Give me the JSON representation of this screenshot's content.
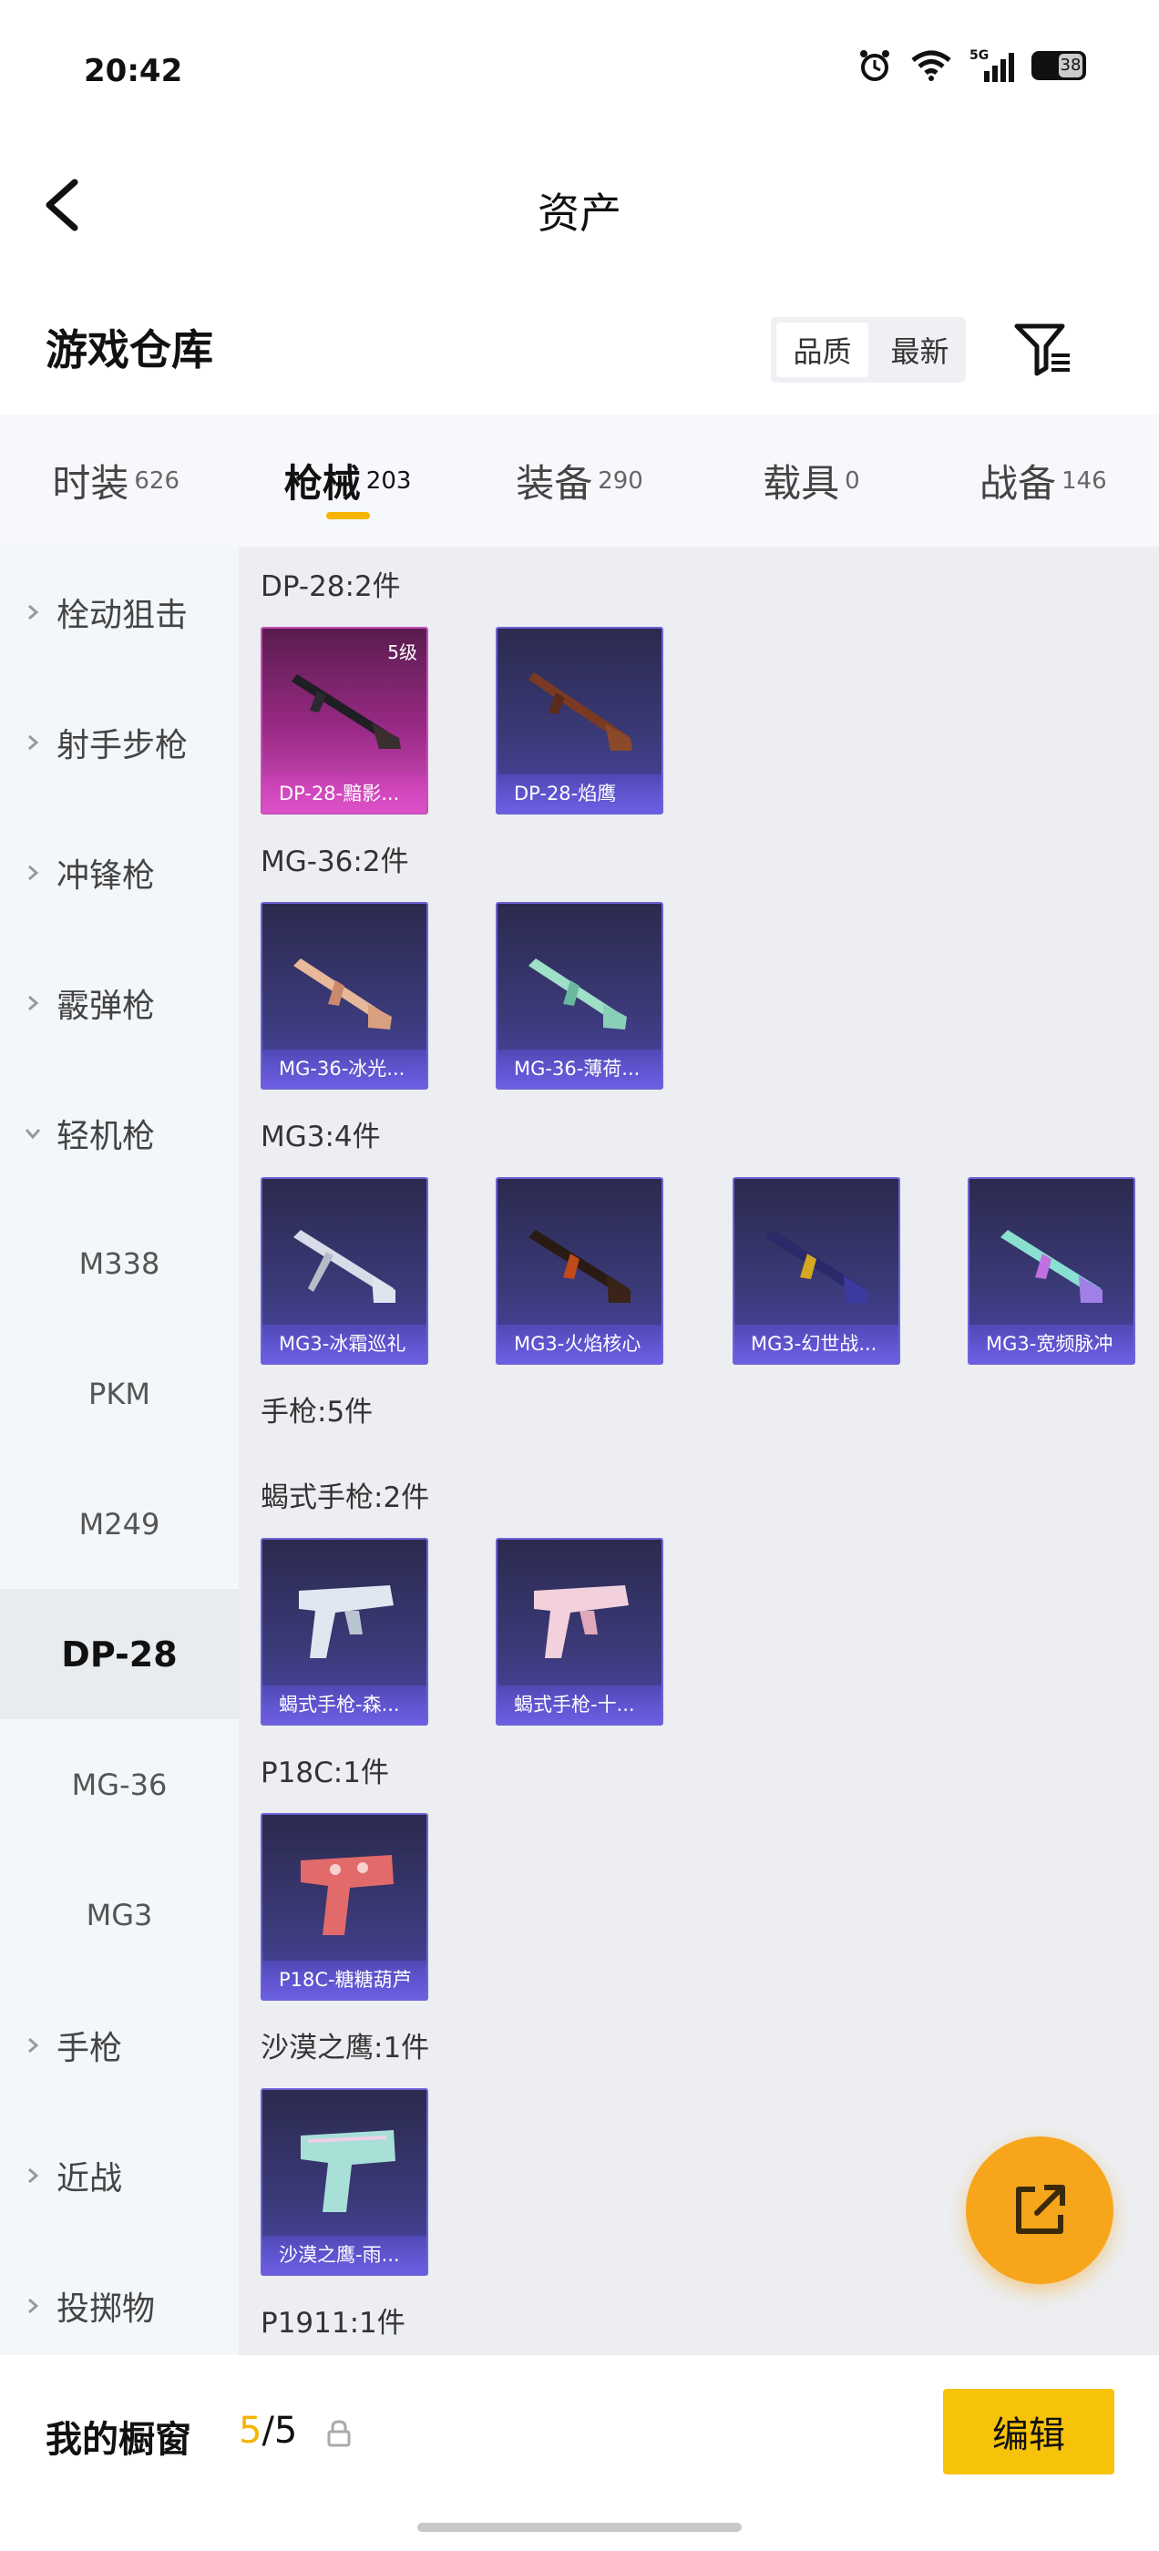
{
  "status_bar": {
    "time": "20:42",
    "battery": "38"
  },
  "header": {
    "title": "资产"
  },
  "warehouse": {
    "title": "游戏仓库",
    "sort_options": [
      "品质",
      "最新"
    ]
  },
  "tabs": [
    {
      "label": "时装",
      "count": "626"
    },
    {
      "label": "枪械",
      "count": "203"
    },
    {
      "label": "装备",
      "count": "290"
    },
    {
      "label": "载具",
      "count": "0"
    },
    {
      "label": "战备",
      "count": "146"
    }
  ],
  "sidebar": [
    {
      "label": "栓动狙击"
    },
    {
      "label": "射手步枪"
    },
    {
      "label": "冲锋枪"
    },
    {
      "label": "霰弹枪"
    },
    {
      "label": "轻机枪"
    },
    {
      "label": "M338"
    },
    {
      "label": "PKM"
    },
    {
      "label": "M249"
    },
    {
      "label": "DP-28"
    },
    {
      "label": "MG-36"
    },
    {
      "label": "MG3"
    },
    {
      "label": "手枪"
    },
    {
      "label": "近战"
    },
    {
      "label": "投掷物"
    }
  ],
  "groups": [
    {
      "title": "DP-28:2件",
      "items": [
        {
          "name": "DP-28-黯影...",
          "badge": "5级",
          "color": "pink"
        },
        {
          "name": "DP-28-焰鹰",
          "color": "purple"
        }
      ]
    },
    {
      "title": "MG-36:2件",
      "items": [
        {
          "name": "MG-36-冰光...",
          "color": "purple"
        },
        {
          "name": "MG-36-薄荷...",
          "color": "purple"
        }
      ]
    },
    {
      "title": "MG3:4件",
      "items": [
        {
          "name": "MG3-冰霜巡礼",
          "color": "purple"
        },
        {
          "name": "MG3-火焰核心",
          "color": "purple"
        },
        {
          "name": "MG3-幻世战...",
          "color": "purple"
        },
        {
          "name": "MG3-宽频脉冲",
          "color": "purple"
        }
      ]
    },
    {
      "title": "手枪:5件",
      "items": []
    },
    {
      "title": "蝎式手枪:2件",
      "items": [
        {
          "name": "蝎式手枪-森...",
          "color": "purple"
        },
        {
          "name": "蝎式手枪-十...",
          "color": "purple"
        }
      ]
    },
    {
      "title": "P18C:1件",
      "items": [
        {
          "name": "P18C-糖糖葫芦",
          "color": "purple"
        }
      ]
    },
    {
      "title": "沙漠之鹰:1件",
      "items": [
        {
          "name": "沙漠之鹰-雨...",
          "color": "purple"
        }
      ]
    },
    {
      "title": "P1911:1件",
      "items": []
    }
  ],
  "bottom": {
    "showcase_label": "我的橱窗",
    "showcase_current": "5",
    "showcase_total": "/5",
    "edit_label": "编辑"
  },
  "colors": {
    "accent": "#f5b400",
    "fab": "#f7a51a",
    "card_border": "#6c63d6"
  }
}
